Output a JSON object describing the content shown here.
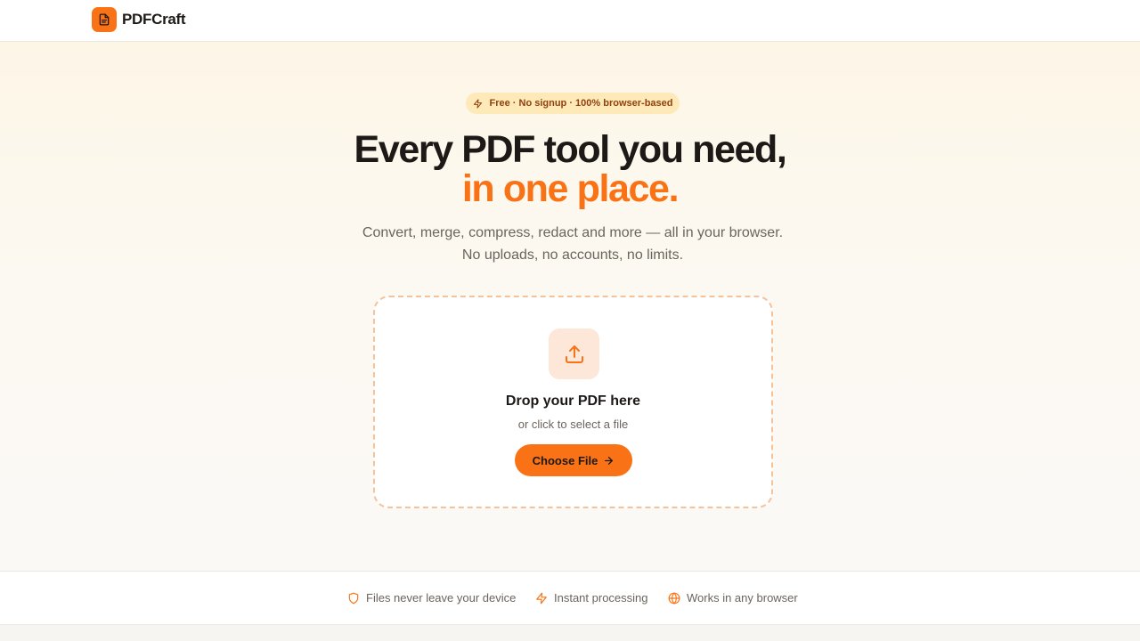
{
  "header": {
    "brand_name": "PDFCraft",
    "logo_icon": "document-icon"
  },
  "hero": {
    "badge": "Free · No signup · 100% browser-based",
    "badge_icon": "lightning-icon",
    "title_line1": "Every PDF tool you need,",
    "title_line2": "in one place.",
    "subtitle_line1": "Convert, merge, compress, redact and more — all in your browser.",
    "subtitle_line2": "No uploads, no accounts, no limits."
  },
  "dropzone": {
    "icon": "upload-icon",
    "title": "Drop your PDF here",
    "subtitle": "or click to select a file",
    "button_label": "Choose File"
  },
  "features": [
    {
      "icon": "shield-icon",
      "label": "Files never leave your device"
    },
    {
      "icon": "lightning-icon",
      "label": "Instant processing"
    },
    {
      "icon": "globe-icon",
      "label": "Works in any browser"
    }
  ],
  "colors": {
    "accent": "#f97316",
    "badge_bg": "#fdeab8",
    "badge_text": "#92400e",
    "text_primary": "#1c1917",
    "text_muted": "#6b645d"
  }
}
